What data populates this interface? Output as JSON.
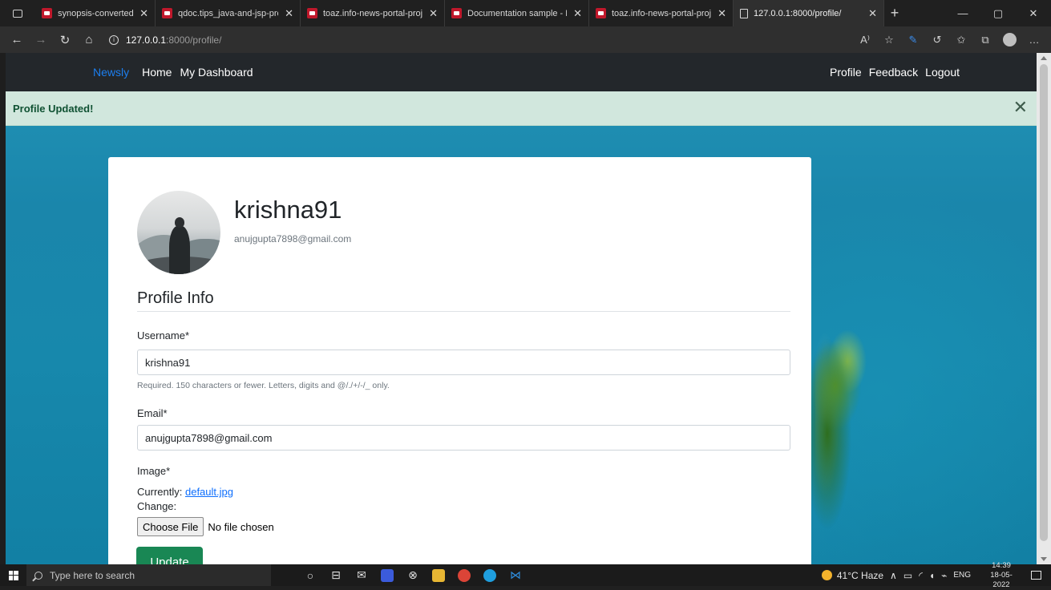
{
  "browser": {
    "tabs": [
      {
        "title": "synopsis-converted.pdf",
        "active": false
      },
      {
        "title": "qdoc.tips_java-and-jsp-proj",
        "active": false
      },
      {
        "title": "toaz.info-news-portal-proje",
        "active": false
      },
      {
        "title": "Documentation sample - Ed",
        "active": false
      },
      {
        "title": "toaz.info-news-portal-proje",
        "active": false
      },
      {
        "title": "127.0.0.1:8000/profile/",
        "active": true
      }
    ],
    "url_host": "127.0.0.1",
    "url_path": ":8000/profile/"
  },
  "site": {
    "brand": "Newsly",
    "nav_left": [
      "Home",
      "My Dashboard"
    ],
    "nav_right": [
      "Profile",
      "Feedback",
      "Logout"
    ]
  },
  "alert": {
    "message": "Profile Updated!"
  },
  "profile": {
    "username": "krishna91",
    "email": "anujgupta7898@gmail.com",
    "section_title": "Profile Info"
  },
  "form": {
    "username_label": "Username*",
    "username_value": "krishna91",
    "username_help": "Required. 150 characters or fewer. Letters, digits and @/./+/-/_ only.",
    "email_label": "Email*",
    "email_value": "anujgupta7898@gmail.com",
    "image_label": "Image*",
    "currently_label": "Currently:",
    "currently_file": "default.jpg",
    "change_label": "Change:",
    "choose_file": "Choose File",
    "no_file": "No file chosen",
    "submit": "Update"
  },
  "taskbar": {
    "search_placeholder": "Type here to search",
    "weather": "41°C Haze",
    "language": "ENG",
    "time": "14:39",
    "date": "18-05-2022"
  },
  "colors": {
    "brand": "#1c7eee",
    "navbar": "#23272b",
    "alert_bg": "#d1e7dd",
    "alert_text": "#0f5132",
    "update_button": "#198754",
    "link": "#0d6efd"
  }
}
